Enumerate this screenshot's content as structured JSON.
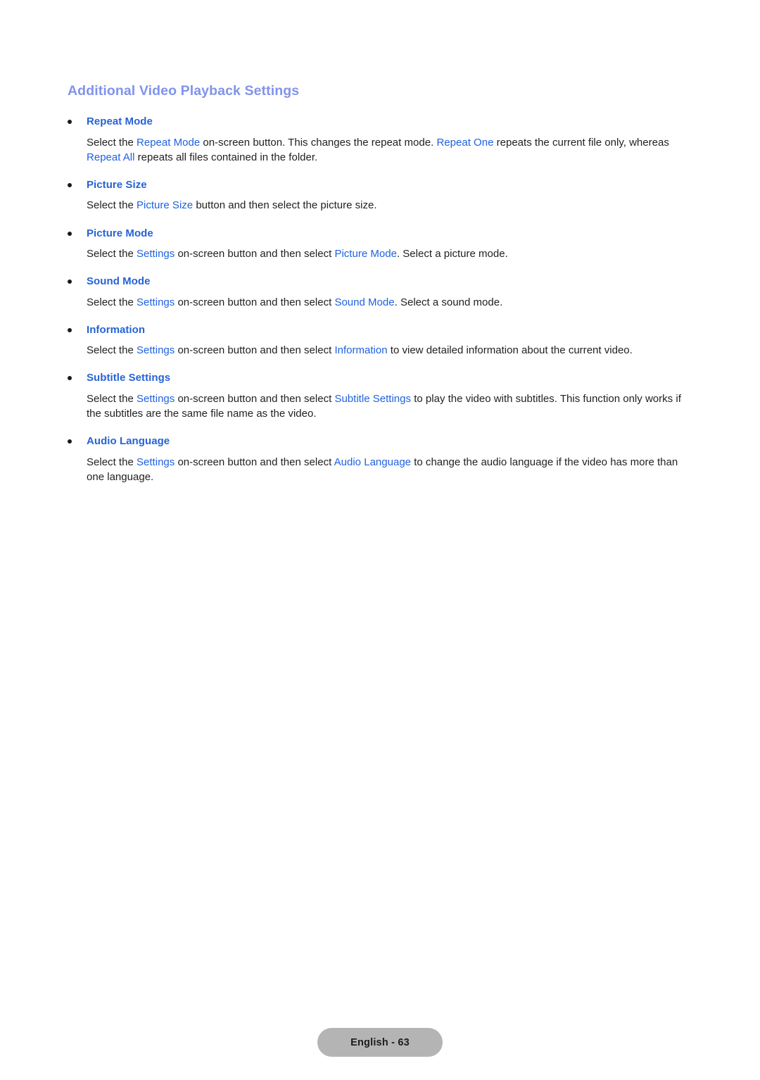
{
  "document": {
    "title": "Additional Video Playback Settings",
    "title_color": "#8193ec",
    "heading_color": "#2563d6",
    "link_color": "#1f62e0",
    "body_color": "#242021",
    "background_color": "#ffffff"
  },
  "sections": [
    {
      "heading": "Repeat Mode",
      "body_parts": [
        {
          "text": "Select the ",
          "link": false
        },
        {
          "text": "Repeat Mode",
          "link": true
        },
        {
          "text": " on-screen button. This changes the repeat mode. ",
          "link": false
        },
        {
          "text": "Repeat One",
          "link": true
        },
        {
          "text": " repeats the current file only, whereas ",
          "link": false
        },
        {
          "text": "Repeat All",
          "link": true
        },
        {
          "text": " repeats all files contained in the folder.",
          "link": false
        }
      ]
    },
    {
      "heading": "Picture Size",
      "body_parts": [
        {
          "text": "Select the ",
          "link": false
        },
        {
          "text": "Picture Size",
          "link": true
        },
        {
          "text": " button and then select the picture size.",
          "link": false
        }
      ]
    },
    {
      "heading": "Picture Mode",
      "body_parts": [
        {
          "text": "Select the ",
          "link": false
        },
        {
          "text": "Settings",
          "link": true
        },
        {
          "text": " on-screen button and then select ",
          "link": false
        },
        {
          "text": "Picture Mode",
          "link": true
        },
        {
          "text": ". Select a picture mode.",
          "link": false
        }
      ]
    },
    {
      "heading": "Sound Mode",
      "body_parts": [
        {
          "text": "Select the ",
          "link": false
        },
        {
          "text": "Settings",
          "link": true
        },
        {
          "text": " on-screen button and then select ",
          "link": false
        },
        {
          "text": "Sound Mode",
          "link": true
        },
        {
          "text": ". Select a sound mode.",
          "link": false
        }
      ]
    },
    {
      "heading": "Information",
      "body_parts": [
        {
          "text": "Select the ",
          "link": false
        },
        {
          "text": "Settings",
          "link": true
        },
        {
          "text": " on-screen button and then select ",
          "link": false
        },
        {
          "text": "Information",
          "link": true
        },
        {
          "text": " to view detailed information about the current video.",
          "link": false
        }
      ]
    },
    {
      "heading": "Subtitle Settings",
      "body_parts": [
        {
          "text": "Select the ",
          "link": false
        },
        {
          "text": "Settings",
          "link": true
        },
        {
          "text": " on-screen button and then select ",
          "link": false
        },
        {
          "text": "Subtitle Settings",
          "link": true
        },
        {
          "text": " to play the video with subtitles. This function only works if the subtitles are the same file name as the video.",
          "link": false
        }
      ]
    },
    {
      "heading": "Audio Language",
      "body_parts": [
        {
          "text": "Select the ",
          "link": false
        },
        {
          "text": "Settings",
          "link": true
        },
        {
          "text": " on-screen button and then select ",
          "link": false
        },
        {
          "text": "Audio Language",
          "link": true
        },
        {
          "text": " to change the audio language if the video has more than one language.",
          "link": false
        }
      ]
    }
  ],
  "footer": {
    "page_label": "English - 63",
    "badge_color": "#b4b4b4"
  }
}
